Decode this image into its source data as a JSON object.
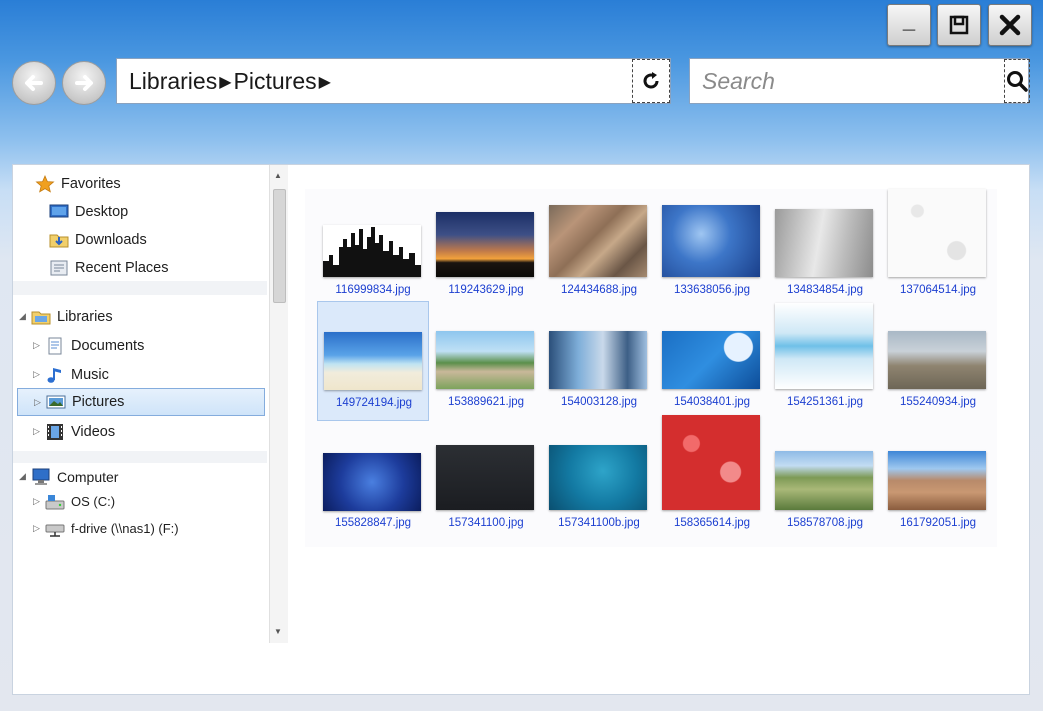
{
  "window": {
    "minimize_label": "_",
    "maximize_icon": "restore-icon",
    "close_icon": "close-icon"
  },
  "nav_buttons": {
    "back_icon": "back-arrow-icon",
    "forward_icon": "forward-arrow-icon"
  },
  "address": {
    "crumbs": [
      "Libraries",
      "Pictures"
    ],
    "refresh_icon": "refresh-icon"
  },
  "search": {
    "placeholder": "Search",
    "icon": "magnifier-icon"
  },
  "sidebar": {
    "favorites": {
      "label": "Favorites",
      "items": [
        "Desktop",
        "Downloads",
        "Recent Places"
      ]
    },
    "libraries": {
      "label": "Libraries",
      "items": [
        "Documents",
        "Music",
        "Pictures",
        "Videos"
      ],
      "selected": "Pictures"
    },
    "computer": {
      "label": "Computer",
      "items": [
        "OS (C:)",
        "f-drive (\\\\nas1) (F:)"
      ]
    }
  },
  "files": [
    {
      "name": "116999834.jpg"
    },
    {
      "name": "119243629.jpg"
    },
    {
      "name": "124434688.jpg"
    },
    {
      "name": "133638056.jpg"
    },
    {
      "name": "134834854.jpg"
    },
    {
      "name": "137064514.jpg"
    },
    {
      "name": "149724194.jpg",
      "selected": true
    },
    {
      "name": "153889621.jpg"
    },
    {
      "name": "154003128.jpg"
    },
    {
      "name": "154038401.jpg"
    },
    {
      "name": "154251361.jpg"
    },
    {
      "name": "155240934.jpg"
    },
    {
      "name": "155828847.jpg"
    },
    {
      "name": "157341100.jpg"
    },
    {
      "name": "157341100b.jpg"
    },
    {
      "name": "158365614.jpg"
    },
    {
      "name": "158578708.jpg"
    },
    {
      "name": "161792051.jpg"
    }
  ]
}
